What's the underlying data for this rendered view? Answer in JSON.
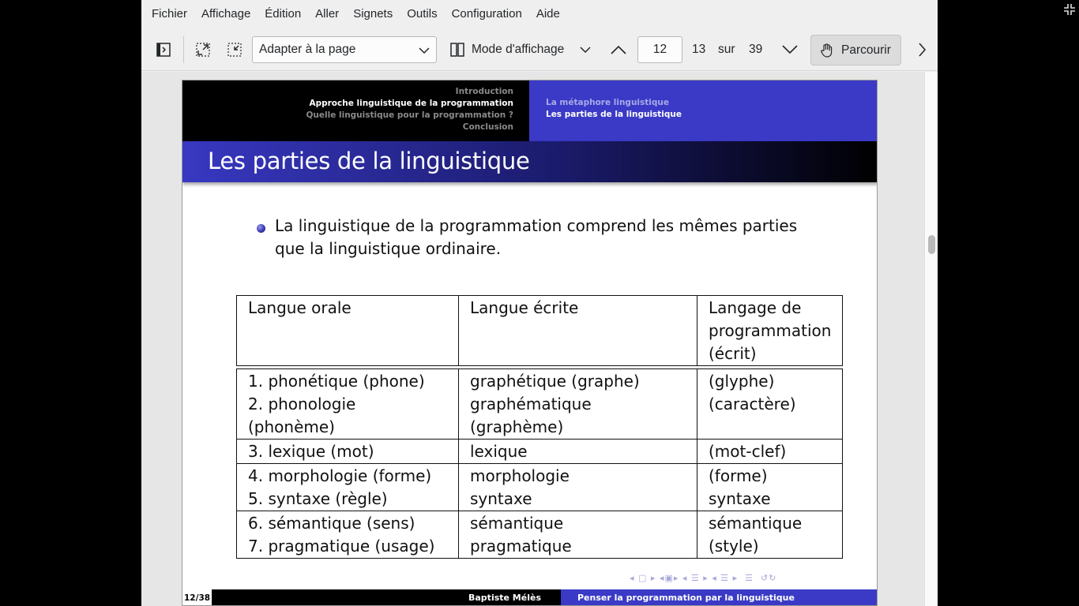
{
  "menubar": {
    "items": [
      "Fichier",
      "Affichage",
      "Édition",
      "Aller",
      "Signets",
      "Outils",
      "Configuration",
      "Aide"
    ]
  },
  "toolbar": {
    "zoom_value": "Adapter à la page",
    "view_mode_label": "Mode d'affichage",
    "page_input": "12",
    "page_label": "13",
    "of_label": "sur",
    "total_pages": "39",
    "browse_label": "Parcourir"
  },
  "slide": {
    "headline_sections": [
      "Introduction",
      "Approche linguistique de la programmation",
      "Quelle linguistique pour la programmation ?",
      "Conclusion"
    ],
    "headline_subsections": [
      "La métaphore linguistique",
      "Les parties de la linguistique"
    ],
    "frame_title": "Les parties de la linguistique",
    "bullet_line1": "La linguistique de la programmation comprend les mêmes parties",
    "bullet_line2": "que la linguistique ordinaire.",
    "table": {
      "headers": [
        "Langue orale",
        "Langue écrite",
        "Langage de",
        "programmation",
        "(écrit)"
      ],
      "rows": [
        [
          "1. phonétique (phone)",
          "graphétique (graphe)",
          "(glyphe)"
        ],
        [
          "2. phonologie (phonème)",
          "graphématique (graphème)",
          "(caractère)"
        ],
        [
          "3. lexique (mot)",
          "lexique",
          "(mot-clef)"
        ],
        [
          "4. morphologie (forme)",
          "morphologie",
          "(forme)"
        ],
        [
          "5. syntaxe (règle)",
          "syntaxe",
          "syntaxe"
        ],
        [
          "6. sémantique (sens)",
          "sémantique",
          "sémantique"
        ],
        [
          "7. pragmatique (usage)",
          "pragmatique",
          "(style)"
        ]
      ]
    },
    "footer_page": "12/38",
    "footer_author": "Baptiste Mélès",
    "footer_title": "Penser la programmation par la linguistique"
  },
  "colors": {
    "beamer_blue": "#3a3ac6",
    "toolbar_bg": "#efefef"
  }
}
